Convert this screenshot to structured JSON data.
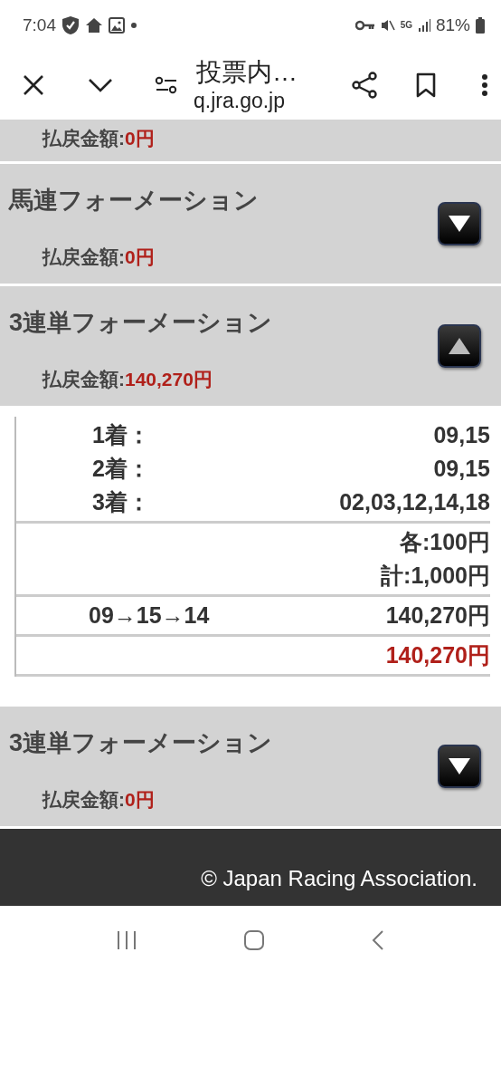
{
  "status_bar": {
    "time": "7:04",
    "network": "5G",
    "battery": "81%"
  },
  "browser": {
    "title": "投票内…",
    "url": "q.jra.go.jp"
  },
  "sections": [
    {
      "kind": "partial",
      "payout_label": "払戻金額:",
      "payout_amount": "0円"
    },
    {
      "kind": "full",
      "title": "馬連フォーメーション",
      "expanded": false,
      "payout_label": "払戻金額:",
      "payout_amount": "0円"
    },
    {
      "kind": "full",
      "title": "3連単フォーメーション",
      "expanded": true,
      "payout_label": "払戻金額:",
      "payout_amount": "140,270円",
      "details": {
        "places": [
          {
            "label": "1着：",
            "value": "09,15"
          },
          {
            "label": "2着：",
            "value": "09,15"
          },
          {
            "label": "3着：",
            "value": "02,03,12,14,18"
          }
        ],
        "unit": "各:100円",
        "total": "計:1,000円",
        "hits": [
          {
            "combo": "09→15→14",
            "amount": "140,270円"
          }
        ],
        "hit_total": "140,270円"
      }
    },
    {
      "kind": "full",
      "title": "3連単フォーメーション",
      "expanded": false,
      "payout_label": "払戻金額:",
      "payout_amount": "0円"
    }
  ],
  "footer": {
    "copyright": "© Japan Racing Association."
  }
}
